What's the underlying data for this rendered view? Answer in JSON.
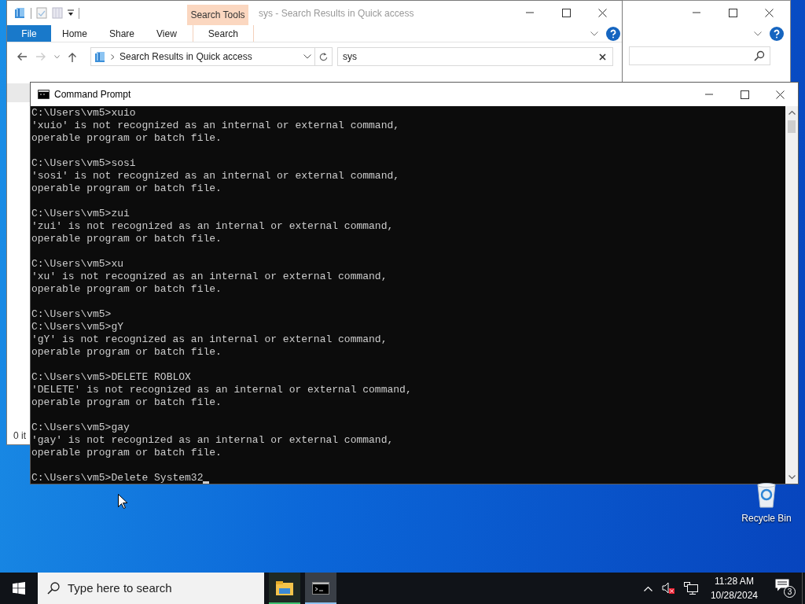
{
  "explorer": {
    "contextual_group": "Search Tools",
    "title": "sys - Search Results in Quick access",
    "ribbon_tabs": [
      {
        "label": "File",
        "kind": "file"
      },
      {
        "label": "Home",
        "kind": "tab"
      },
      {
        "label": "Share",
        "kind": "tab"
      },
      {
        "label": "View",
        "kind": "tab"
      },
      {
        "label": "Search",
        "kind": "contextual"
      }
    ],
    "address": "Search Results in Quick access",
    "search_value": "sys",
    "status": "0 it"
  },
  "console": {
    "title": "Command Prompt",
    "blocks": [
      [
        "C:\\Users\\vm5>xuio",
        "'xuio' is not recognized as an internal or external command,",
        "operable program or batch file."
      ],
      [
        "C:\\Users\\vm5>sosi",
        "'sosi' is not recognized as an internal or external command,",
        "operable program or batch file."
      ],
      [
        "C:\\Users\\vm5>zui",
        "'zui' is not recognized as an internal or external command,",
        "operable program or batch file."
      ],
      [
        "C:\\Users\\vm5>xu",
        "'xu' is not recognized as an internal or external command,",
        "operable program or batch file."
      ],
      [
        "C:\\Users\\vm5>",
        "C:\\Users\\vm5>gY",
        "'gY' is not recognized as an internal or external command,",
        "operable program or batch file."
      ],
      [
        "C:\\Users\\vm5>DELETE ROBLOX",
        "'DELETE' is not recognized as an internal or external command,",
        "operable program or batch file."
      ],
      [
        "C:\\Users\\vm5>gay",
        "'gay' is not recognized as an internal or external command,",
        "operable program or batch file."
      ],
      [
        "C:\\Users\\vm5>Delete System32"
      ]
    ]
  },
  "desktop_icons": [
    {
      "label": "Recycle Bin"
    }
  ],
  "taskbar": {
    "search_placeholder": "Type here to search",
    "apps": [
      {
        "kind": "explorer",
        "active": false
      },
      {
        "kind": "console",
        "active": true
      }
    ],
    "time": "11:28 AM",
    "date": "10/28/2024",
    "notification_count": "3"
  }
}
